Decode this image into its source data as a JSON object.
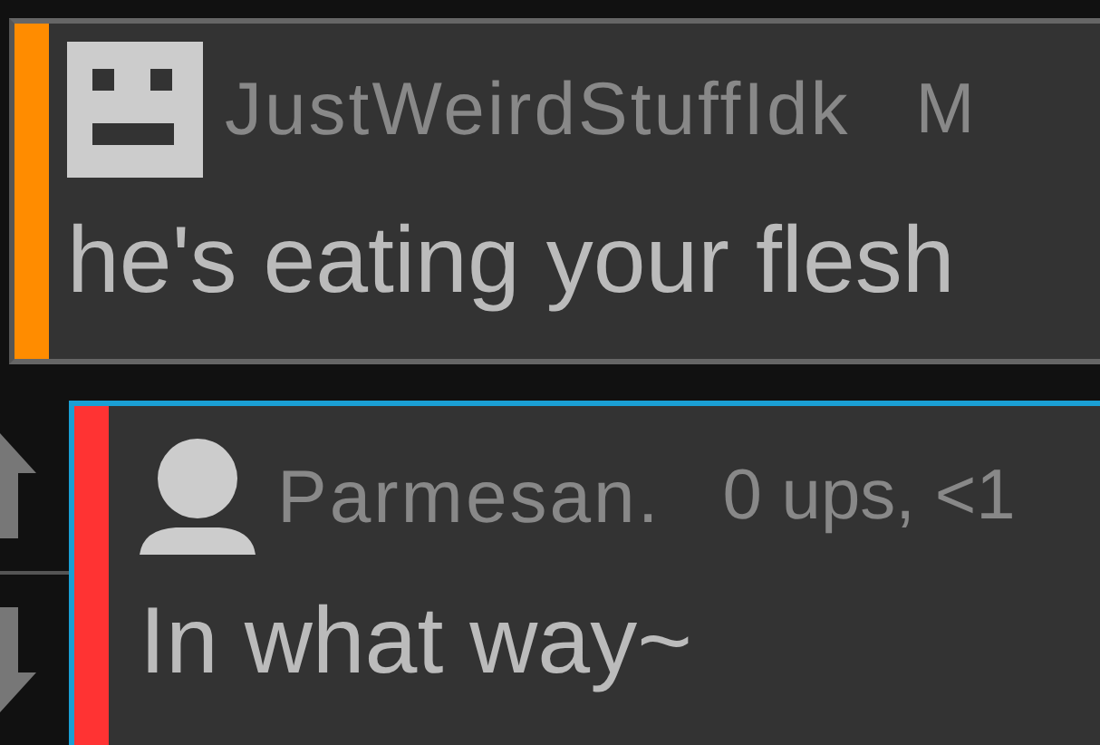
{
  "comments": [
    {
      "kind": "pixel-face",
      "color": "#ff8c00",
      "highlighted": false,
      "votes": false,
      "username": "JustWeirdStuffIdk",
      "meta": "M",
      "text": "he's eating your flesh"
    },
    {
      "kind": "silhouette",
      "color": "#ff3333",
      "highlighted": true,
      "votes": true,
      "username": "Parmesan.",
      "meta": "0 ups, <1",
      "text": "In what way~"
    }
  ]
}
